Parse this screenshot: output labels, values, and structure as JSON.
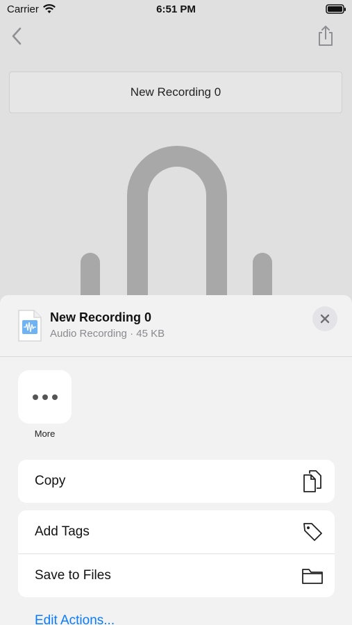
{
  "status_bar": {
    "carrier": "Carrier",
    "time": "6:51 PM"
  },
  "recording_title": "New Recording 0",
  "share_sheet": {
    "file_title": "New Recording 0",
    "file_subtitle": "Audio Recording · 45 KB",
    "more_label": "More",
    "actions_group_1": [
      {
        "label": "Copy",
        "icon": "copy-icon"
      }
    ],
    "actions_group_2": [
      {
        "label": "Add Tags",
        "icon": "tag-icon"
      },
      {
        "label": "Save to Files",
        "icon": "folder-icon"
      }
    ],
    "edit_actions_label": "Edit Actions..."
  },
  "colors": {
    "accent": "#0a7aff",
    "sheet_bg": "#f2f2f2",
    "dimmed_bg": "#e0e0e0"
  }
}
